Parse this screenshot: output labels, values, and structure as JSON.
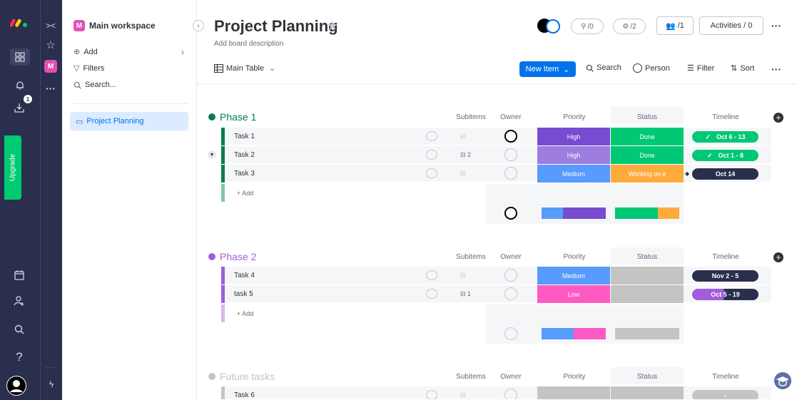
{
  "sidebar": {
    "upgrade_label": "Upgrade",
    "notifications_count": "1"
  },
  "workspace": {
    "title": "Main workspace",
    "badge": "M",
    "add_label": "Add",
    "filters_label": "Filters",
    "search_label": "Search...",
    "board_label": "Project Planning"
  },
  "header": {
    "title": "Project Planning",
    "description": "Add board description",
    "integrations_count": "/0",
    "automations_count": "/2",
    "members_count": "/1",
    "activities_label": "Activities / 0"
  },
  "toolbar": {
    "view_label": "Main Table",
    "new_item_label": "New Item",
    "search_label": "Search",
    "person_label": "Person",
    "filter_label": "Filter",
    "sort_label": "Sort"
  },
  "columns": {
    "subitems": "Subitems",
    "owner": "Owner",
    "priority": "Priority",
    "status": "Status",
    "timeline": "Timeline"
  },
  "groups": [
    {
      "title": "Phase 1",
      "color": "#037f4c",
      "add_label": "+ Add",
      "rows": [
        {
          "name": "Task 1",
          "subitems": "",
          "priority": "High",
          "status": "Done",
          "timeline": "Oct 6 - 13"
        },
        {
          "name": "Task 2",
          "subitems": "2",
          "priority": "High",
          "status": "Done",
          "timeline": "Oct 1 - 8"
        },
        {
          "name": "Task 3",
          "subitems": "",
          "priority": "Medium",
          "status": "Working on it",
          "timeline": "Oct 14"
        }
      ]
    },
    {
      "title": "Phase 2",
      "color": "#a25ddc",
      "add_label": "+ Add",
      "rows": [
        {
          "name": "Task 4",
          "subitems": "",
          "priority": "Medium",
          "status": "",
          "timeline": "Nov 2 - 5"
        },
        {
          "name": "task 5",
          "subitems": "1",
          "priority": "Low",
          "status": "",
          "timeline": "Oct 5 - 19"
        }
      ]
    },
    {
      "title": "Future tasks",
      "color": "#c4c4c4",
      "rows": [
        {
          "name": "Task 6",
          "subitems": "",
          "priority": "",
          "status": "",
          "timeline": "-"
        }
      ]
    }
  ],
  "colors": {
    "high": "#784bd1",
    "high_light": "#9d7de0",
    "medium": "#579bfc",
    "low": "#ff5ac4",
    "done": "#00c875",
    "working": "#fdab3d",
    "empty": "#c4c4c4",
    "accent": "#0073ea"
  }
}
